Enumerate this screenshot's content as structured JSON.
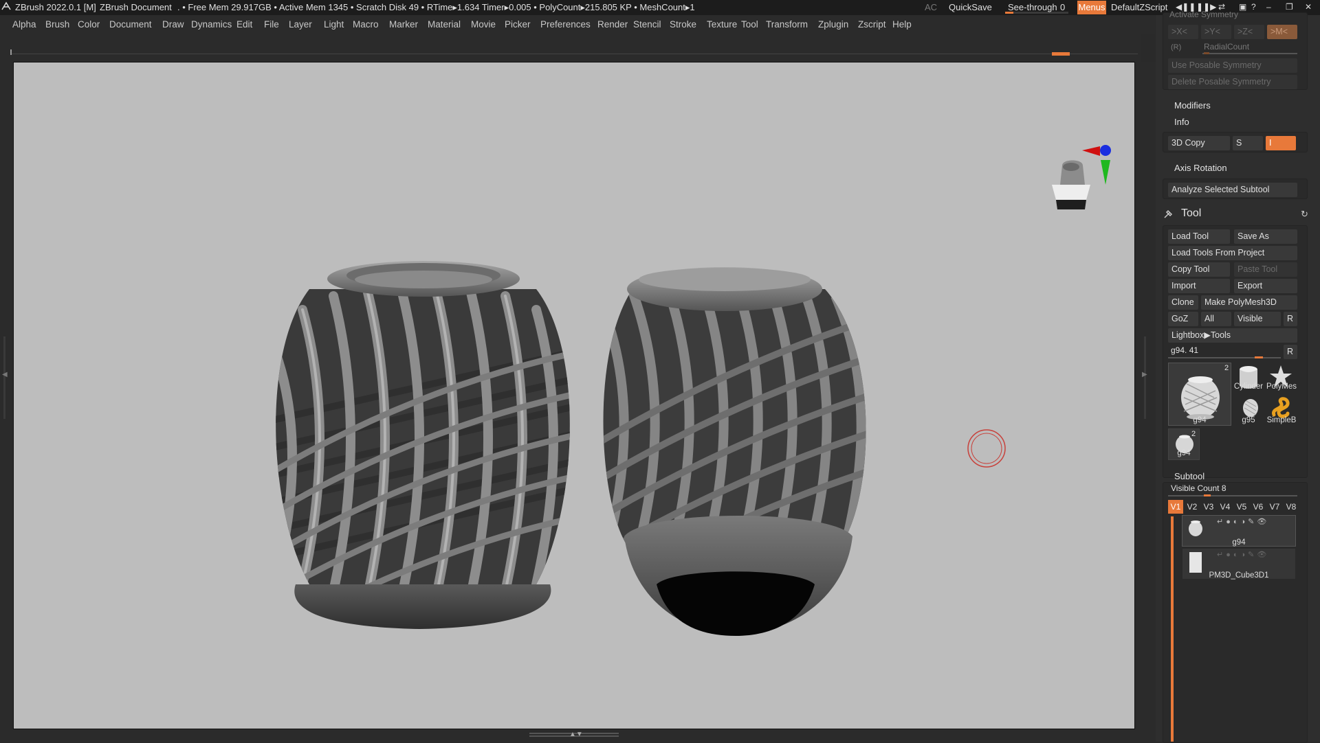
{
  "titlebar": {
    "app": "ZBrush 2022.0.1 [M]",
    "document": "ZBrush Document",
    "stats": ". • Free Mem 29.917GB • Active Mem 1345 • Scratch Disk 49 •  RTime▸1.634 Timer▸0.005 • PolyCount▸215.805 KP  • MeshCount▸1",
    "ac": "AC",
    "quicksave": "QuickSave",
    "see_through_label": "See-through",
    "see_through_value": "0",
    "menus": "Menus",
    "zscript": "DefaultZScript"
  },
  "menubar": {
    "items": [
      "Alpha",
      "Brush",
      "Color",
      "Document",
      "Draw",
      "Dynamics",
      "Edit",
      "File",
      "Layer",
      "Light",
      "Macro",
      "Marker",
      "Material",
      "Movie",
      "Picker",
      "Preferences",
      "Render",
      "Stencil",
      "Stroke",
      "Texture",
      "Tool",
      "Transform",
      "Zplugin",
      "Zscript",
      "Help"
    ]
  },
  "panel": {
    "symmetry": {
      "activate": "Activate Symmetry",
      "x": ">X<",
      "y": ">Y<",
      "z": ">Z<",
      "m": ">M<",
      "r": "(R)",
      "radial": "RadialCount",
      "use_posable": "Use Posable Symmetry",
      "delete_posable": "Delete Posable Symmetry"
    },
    "modifiers": "Modifiers",
    "info": "Info",
    "copy3d": "3D Copy",
    "copy3d_s": "S",
    "copy3d_value": "I",
    "axis_rotation": "Axis Rotation",
    "analyze": "Analyze Selected Subtool",
    "tool": {
      "title": "Tool",
      "load_tool": "Load Tool",
      "save_as": "Save As",
      "load_from_project": "Load Tools From Project",
      "copy_tool": "Copy Tool",
      "paste_tool": "Paste Tool",
      "import": "Import",
      "export": "Export",
      "clone": "Clone",
      "make_polymesh": "Make PolyMesh3D",
      "goz": "GoZ",
      "all": "All",
      "visible": "Visible",
      "r": "R",
      "lightbox": "Lightbox▶Tools",
      "current": "g94. 41",
      "current_r": "R",
      "thumbs": [
        {
          "label": "g94",
          "badge": "2"
        },
        {
          "label": "Cylinder"
        },
        {
          "label": "PolyMes"
        },
        {
          "label": "g95"
        },
        {
          "label": "SimpleB"
        },
        {
          "label": "g94",
          "badge": "2"
        }
      ]
    },
    "subtool": {
      "title": "Subtool",
      "visible_count": "Visible Count 8",
      "tabs": [
        "V1",
        "V2",
        "V3",
        "V4",
        "V5",
        "V6",
        "V7",
        "V8"
      ],
      "items": [
        "g94",
        "PM3D_Cube3D1"
      ]
    }
  },
  "colors": {
    "accent": "#e8793a",
    "canvas": "#bdbdbd",
    "panel": "#2e2e2e"
  }
}
